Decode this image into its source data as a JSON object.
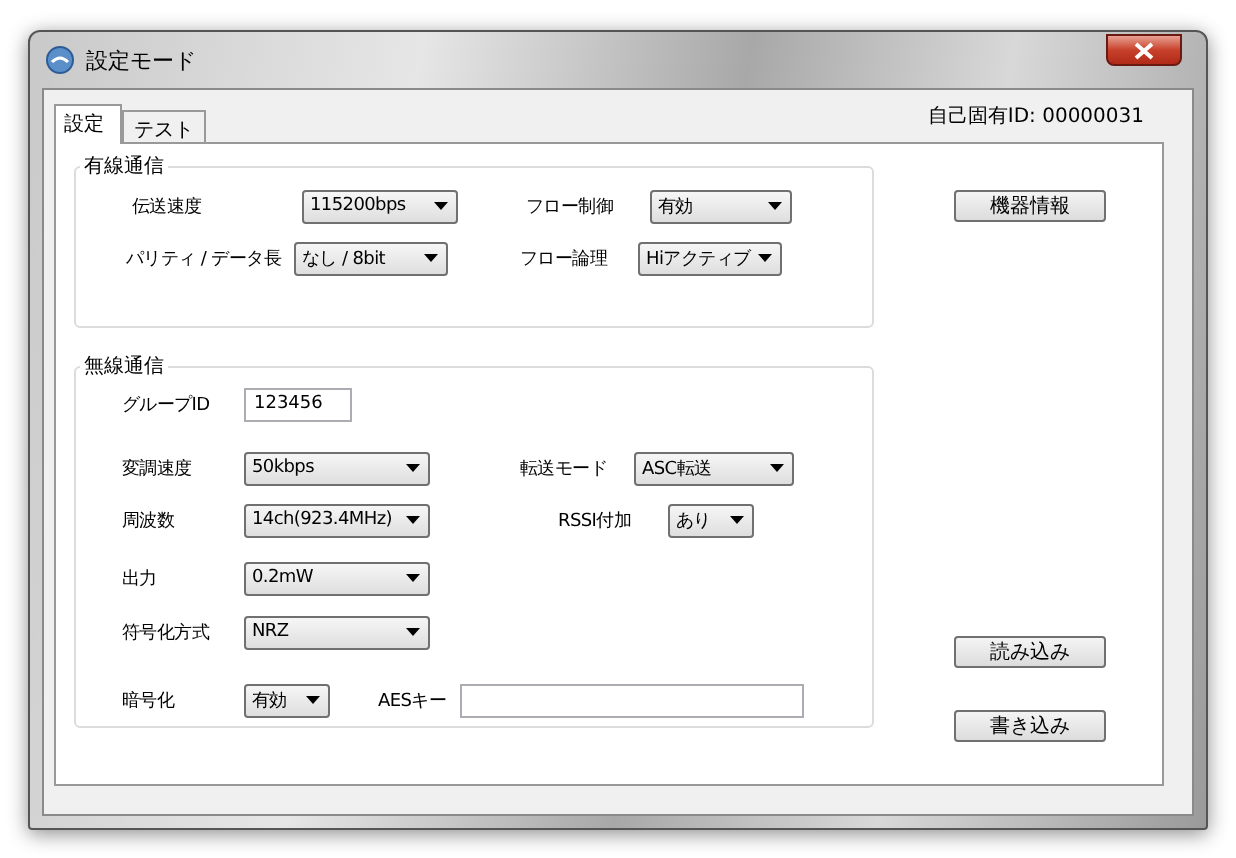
{
  "window": {
    "title": "設定モード"
  },
  "device_id": "自己固有ID: 00000031",
  "tabs": [
    {
      "label": "設定",
      "selected": true
    },
    {
      "label": "テスト",
      "selected": false
    }
  ],
  "wired": {
    "title": "有線通信",
    "rows": [
      [
        {
          "label": "伝送速度",
          "kind": "combo",
          "value": "115200bps"
        },
        {
          "label": "フロー制御",
          "kind": "combo",
          "value": "有効"
        }
      ],
      [
        {
          "label": "パリティ / データ長",
          "kind": "combo",
          "value": "なし / 8bit"
        },
        {
          "label": "フロー論理",
          "kind": "combo",
          "value": "Hiアクティブ"
        }
      ]
    ]
  },
  "wireless": {
    "title": "無線通信",
    "rows": [
      [
        {
          "label": "グループID",
          "kind": "text",
          "value": "123456"
        }
      ],
      [
        {
          "label": "変調速度",
          "kind": "combo",
          "value": "50kbps"
        },
        {
          "label": "転送モード",
          "kind": "combo",
          "value": "ASC転送"
        }
      ],
      [
        {
          "label": "周波数",
          "kind": "combo",
          "value": "14ch(923.4MHz)"
        },
        {
          "label": "RSSI付加",
          "kind": "combo",
          "value": "あり"
        }
      ],
      [
        {
          "label": "出力",
          "kind": "combo",
          "value": "0.2mW"
        }
      ],
      [
        {
          "label": "符号化方式",
          "kind": "combo",
          "value": "NRZ"
        }
      ],
      [
        {
          "label": "暗号化",
          "kind": "combo",
          "value": "有効"
        },
        {
          "label": "AESキー",
          "kind": "text"
        }
      ]
    ]
  },
  "buttons": [
    {
      "label": "機器情報"
    },
    {
      "label": "読み込み"
    },
    {
      "label": "書き込み"
    }
  ]
}
